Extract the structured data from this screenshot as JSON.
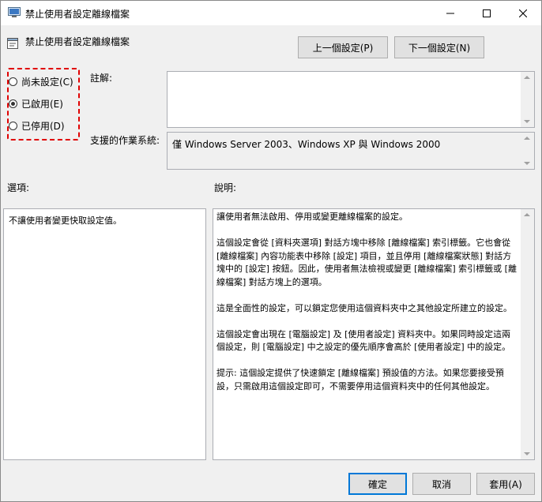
{
  "window": {
    "title": "禁止使用者設定離線檔案"
  },
  "policy": {
    "name": "禁止使用者設定離線檔案"
  },
  "nav": {
    "prev_label": "上一個設定(P)",
    "next_label": "下一個設定(N)"
  },
  "state": {
    "options": [
      {
        "label": "尚未設定(C)",
        "checked": false
      },
      {
        "label": "已啟用(E)",
        "checked": true
      },
      {
        "label": "已停用(D)",
        "checked": false
      }
    ]
  },
  "comment": {
    "label": "註解:",
    "value": ""
  },
  "supported": {
    "label": "支援的作業系統:",
    "value": "僅 Windows Server 2003、Windows XP 與 Windows 2000"
  },
  "options_section": {
    "label": "選項:",
    "text": "不讓使用者變更快取設定值。"
  },
  "help_section": {
    "label": "說明:",
    "paragraphs": [
      "讓使用者無法啟用、停用或變更離線檔案的設定。",
      "這個設定會從 [資料夾選項] 對話方塊中移除 [離線檔案] 索引標籤。它也會從 [離線檔案] 內容功能表中移除 [設定] 項目，並且停用 [離線檔案狀態] 對話方塊中的 [設定] 按鈕。因此，使用者無法檢視或變更 [離線檔案] 索引標籤或 [離線檔案] 對話方塊上的選項。",
      "這是全面性的設定，可以鎖定您使用這個資料夾中之其他設定所建立的設定。",
      "這個設定會出現在 [電腦設定] 及 [使用者設定] 資料夾中。如果同時設定這兩個設定，則 [電腦設定] 中之設定的優先順序會高於 [使用者設定] 中的設定。",
      "提示: 這個設定提供了快速鎖定 [離線檔案] 預設值的方法。如果您要接受預設，只需啟用這個設定即可，不需要停用這個資料夾中的任何其他設定。"
    ]
  },
  "buttons": {
    "ok": "確定",
    "cancel": "取消",
    "apply": "套用(A)"
  },
  "colors": {
    "highlight": "#e00000",
    "accent": "#0078d7"
  }
}
